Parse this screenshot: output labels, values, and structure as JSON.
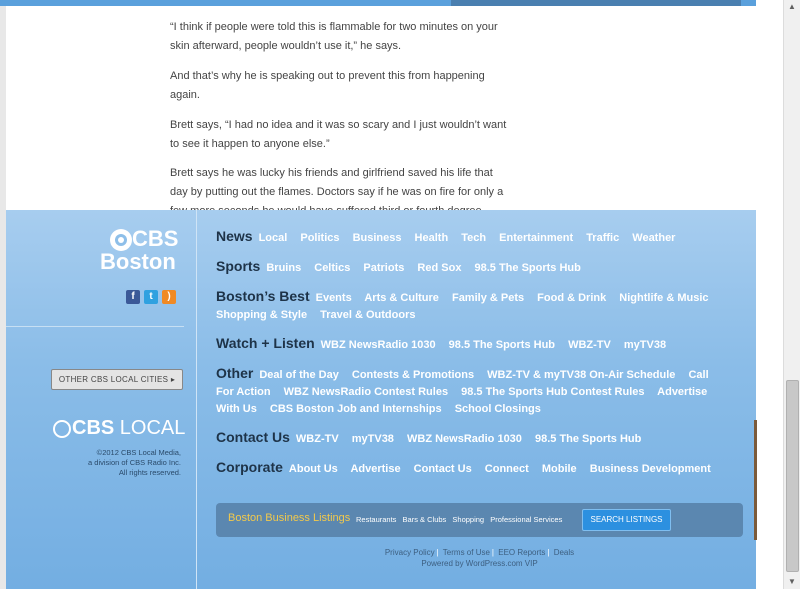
{
  "article": {
    "paragraphs": [
      "“I think if people were told this is flammable for two minutes on your skin afterward, people wouldn’t use it,” he says.",
      "And that’s why he is speaking out to prevent this from happening again.",
      "Brett says, “I had no idea and it was so scary and I just wouldn’t want to see it happen to anyone else.”",
      "Brett says he was lucky his friends and girlfriend saved his life that day by putting out the flames. Doctors say if he was on fire for only a few more seconds he would have suffered third or fourth degree"
    ]
  },
  "footer": {
    "logo": {
      "line1": "CBS",
      "line2": "Boston"
    },
    "social_icons": [
      "facebook-icon",
      "twitter-icon",
      "rss-icon"
    ],
    "other_cities_label": "OTHER CBS LOCAL CITIES ▸",
    "local_logo": {
      "bold": "CBS",
      "light": "LOCAL"
    },
    "copyright": [
      "©2012 CBS Local Media,",
      "a division of CBS Radio Inc.",
      "All rights reserved."
    ],
    "sections": [
      {
        "heading": "News",
        "links": [
          "Local",
          "Politics",
          "Business",
          "Health",
          "Tech",
          "Entertainment",
          "Traffic",
          "Weather"
        ]
      },
      {
        "heading": "Sports",
        "links": [
          "Bruins",
          "Celtics",
          "Patriots",
          "Red Sox",
          "98.5 The Sports Hub"
        ]
      },
      {
        "heading": "Boston’s Best",
        "links": [
          "Events",
          "Arts & Culture",
          "Family & Pets",
          "Food & Drink",
          "Nightlife & Music",
          "Shopping & Style",
          "Travel & Outdoors"
        ]
      },
      {
        "heading": "Watch + Listen",
        "links": [
          "WBZ NewsRadio 1030",
          "98.5 The Sports Hub",
          "WBZ-TV",
          "myTV38"
        ]
      },
      {
        "heading": "Other",
        "links": [
          "Deal of the Day",
          "Contests & Promotions",
          "WBZ-TV & myTV38 On-Air Schedule",
          "Call For Action",
          "WBZ NewsRadio Contest Rules",
          "98.5 The Sports Hub Contest Rules",
          "Advertise With Us",
          "CBS Boston Job and Internships",
          "School Closings"
        ]
      },
      {
        "heading": "Contact Us",
        "links": [
          "WBZ-TV",
          "myTV38",
          "WBZ NewsRadio 1030",
          "98.5 The Sports Hub"
        ]
      },
      {
        "heading": "Corporate",
        "links": [
          "About Us",
          "Advertise",
          "Contact Us",
          "Connect",
          "Mobile",
          "Business Development"
        ]
      }
    ],
    "listings": {
      "title": "Boston Business Listings",
      "categories": [
        "Restaurants",
        "Bars & Clubs",
        "Shopping",
        "Professional Services"
      ],
      "search_label": "SEARCH LISTINGS"
    },
    "legal": {
      "links": [
        "Privacy Policy",
        "Terms of Use",
        "EEO Reports",
        "Deals"
      ],
      "powered": "Powered by WordPress.com VIP"
    }
  },
  "scrollbar": {
    "up": "▲",
    "down": "▼"
  }
}
